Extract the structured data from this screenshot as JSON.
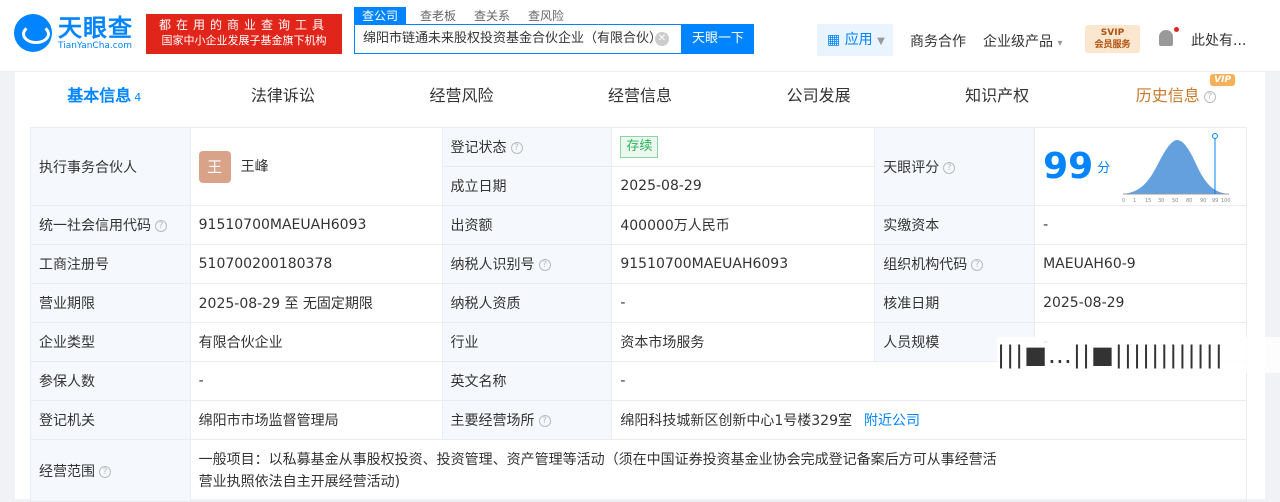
{
  "header": {
    "logo_cn": "天眼查",
    "logo_en": "TianYanCha.com",
    "slogan_line1": "都在用的商业查询工具",
    "slogan_line2": "国家中小企业发展子基金旗下机构",
    "search_tabs": [
      "查公司",
      "查老板",
      "查关系",
      "查风险"
    ],
    "search_value": "绵阳市链通未来股权投资基金合伙企业（有限合伙）",
    "search_button": "天眼一下",
    "apps_label": "应用",
    "business": "商务合作",
    "enterprise": "企业级产品",
    "svip_top": "SVIP",
    "svip_bottom": "会员服务",
    "user": "此处有..."
  },
  "tabs": [
    {
      "label": "基本信息",
      "count": "4"
    },
    {
      "label": "法律诉讼"
    },
    {
      "label": "经营风险"
    },
    {
      "label": "经营信息"
    },
    {
      "label": "公司发展"
    },
    {
      "label": "知识产权"
    },
    {
      "label": "历史信息",
      "tag": "VIP"
    }
  ],
  "info": {
    "partner_label": "执行事务合伙人",
    "partner_avatar": "王",
    "partner_name": "王峰",
    "status_label": "登记状态",
    "status_value": "存续",
    "founded_label": "成立日期",
    "founded_value": "2025-08-29",
    "score_label": "天眼评分",
    "score_value": "99",
    "score_unit": "分",
    "score_axis": [
      "0",
      "1",
      "15",
      "30",
      "50",
      "80",
      "90",
      "99",
      "100"
    ],
    "credit_label": "统一社会信用代码",
    "credit_value": "91510700MAEUAH6093",
    "capital_label": "出资额",
    "capital_value": "400000万人民币",
    "paid_label": "实缴资本",
    "paid_value": "-",
    "reg_no_label": "工商注册号",
    "reg_no_value": "510700200180378",
    "tax_id_label": "纳税人识别号",
    "tax_id_value": "91510700MAEUAH6093",
    "org_code_label": "组织机构代码",
    "org_code_value": "MAEUAH60-9",
    "term_label": "营业期限",
    "term_value": "2025-08-29 至 无固定期限",
    "tax_qual_label": "纳税人资质",
    "tax_qual_value": "-",
    "approve_label": "核准日期",
    "approve_value": "2025-08-29",
    "type_label": "企业类型",
    "type_value": "有限合伙企业",
    "industry_label": "行业",
    "industry_value": "资本市场服务",
    "staff_label": "人员规模",
    "staff_value": "-",
    "insured_label": "参保人数",
    "insured_value": "-",
    "en_name_label": "英文名称",
    "en_name_value": "-",
    "authority_label": "登记机关",
    "authority_value": "绵阳市市场监督管理局",
    "address_label": "主要经营场所",
    "address_value": "绵阳科技城新区创新中心1号楼329室",
    "nearby_link": "附近公司",
    "scope_label": "经营范围",
    "scope_line1": "一般项目：以私募基金从事股权投资、投资管理、资产管理等活动（须在中国证券投资基金业协会完成登记备案后方可从事经营活",
    "scope_line2": "营业执照依法自主开展经营活动)"
  },
  "watermark": "|||■…||■||||||||||||"
}
